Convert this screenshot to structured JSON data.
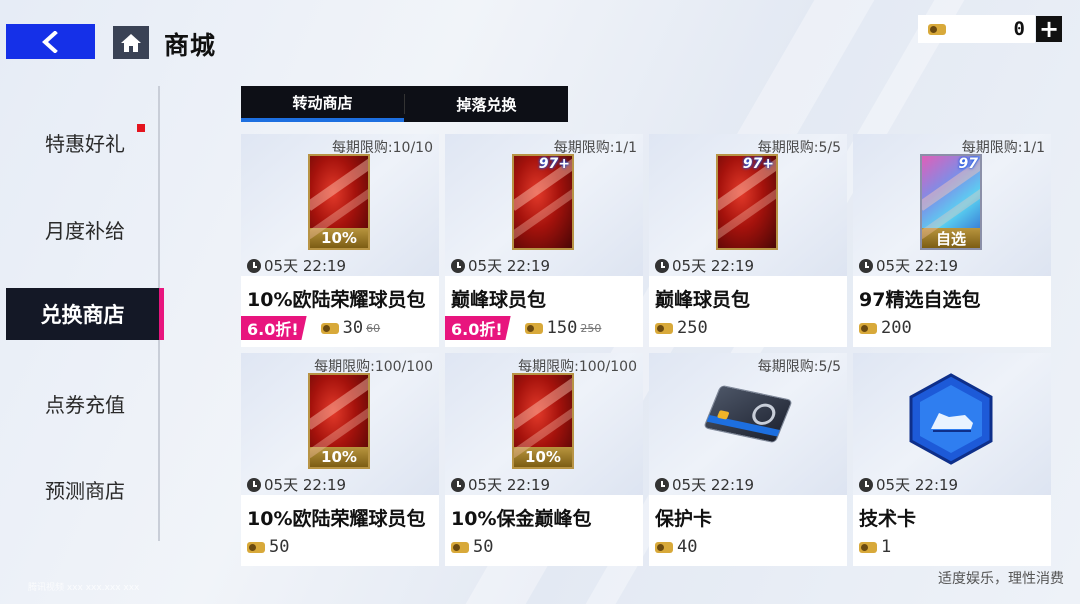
{
  "header": {
    "title": "商城",
    "currency_amount": "0",
    "plus_label": "+"
  },
  "sidebar": {
    "items": [
      {
        "label": "特惠好礼",
        "has_badge": true
      },
      {
        "label": "月度补给"
      },
      {
        "label": "兑换商店",
        "active": true
      },
      {
        "label": "点券充值"
      },
      {
        "label": "预测商店"
      }
    ]
  },
  "tabs": [
    {
      "label": "转动商店",
      "active": true
    },
    {
      "label": "掉落兑换"
    }
  ],
  "products": [
    {
      "limit": "每期限购:10/10",
      "timer": "05天 22:19",
      "name": "10%欧陆荣耀球员包",
      "discount": "6.0折!",
      "price": "30",
      "old_price": "60",
      "pack_label": "10%"
    },
    {
      "limit": "每期限购:1/1",
      "timer": "05天 22:19",
      "name": "巅峰球员包",
      "discount": "6.0折!",
      "price": "150",
      "old_price": "250",
      "pack_rating": "97+"
    },
    {
      "limit": "每期限购:5/5",
      "timer": "05天 22:19",
      "name": "巅峰球员包",
      "price": "250",
      "pack_rating": "97+"
    },
    {
      "limit": "每期限购:1/1",
      "timer": "05天 22:19",
      "name": "97精选自选包",
      "price": "200",
      "pack_rating": "97",
      "pack_label": "自选"
    },
    {
      "limit": "每期限购:100/100",
      "timer": "05天 22:19",
      "name": "10%欧陆荣耀球员包",
      "price": "50",
      "pack_label": "10%"
    },
    {
      "limit": "每期限购:100/100",
      "timer": "05天 22:19",
      "name": "10%保金巅峰包",
      "price": "50",
      "pack_label": "10%"
    },
    {
      "limit": "每期限购:5/5",
      "timer": "05天 22:19",
      "name": "保护卡",
      "price": "40"
    },
    {
      "limit": "",
      "timer": "05天 22:19",
      "name": "技术卡",
      "price": "1"
    }
  ],
  "footer_note": "适度娱乐，理性消费",
  "watermark": "腾讯视频 xxx xxx.xxx xxx",
  "colors": {
    "accent_blue": "#1530e8",
    "discount_pink": "#e8157e",
    "tab_bg": "#0d0f16"
  }
}
